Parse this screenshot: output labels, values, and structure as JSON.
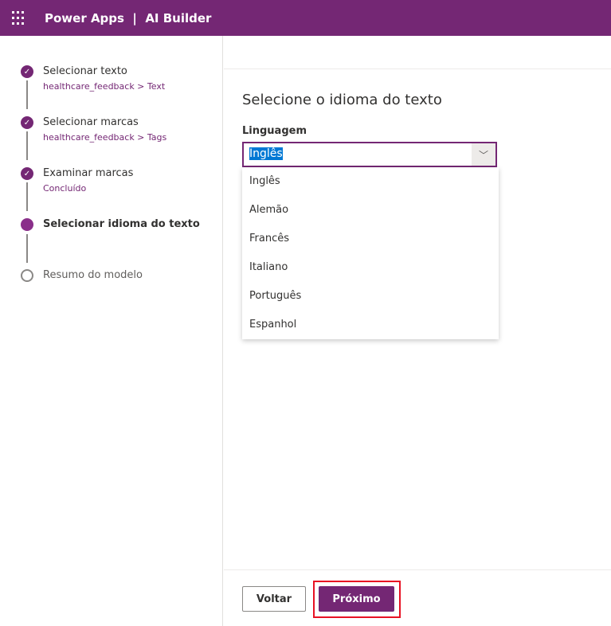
{
  "header": {
    "title": "Power Apps  |  AI Builder"
  },
  "steps": [
    {
      "label": "Selecionar texto",
      "sub": "healthcare_feedback > Text",
      "state": "done"
    },
    {
      "label": "Selecionar marcas",
      "sub": "healthcare_feedback > Tags",
      "state": "done"
    },
    {
      "label": "Examinar marcas",
      "sub": "Concluído",
      "state": "done"
    },
    {
      "label": "Selecionar idioma do texto",
      "state": "current"
    },
    {
      "label": "Resumo do modelo",
      "state": "todo"
    }
  ],
  "main": {
    "heading": "Selecione o idioma do texto",
    "field_label": "Linguagem",
    "selected": "Inglês",
    "options": [
      "Inglês",
      "Alemão",
      "Francês",
      "Italiano",
      "Português",
      "Espanhol"
    ]
  },
  "footer": {
    "back": "Voltar",
    "next": "Próximo"
  },
  "colors": {
    "brand": "#742774",
    "highlight": "#e81123"
  }
}
